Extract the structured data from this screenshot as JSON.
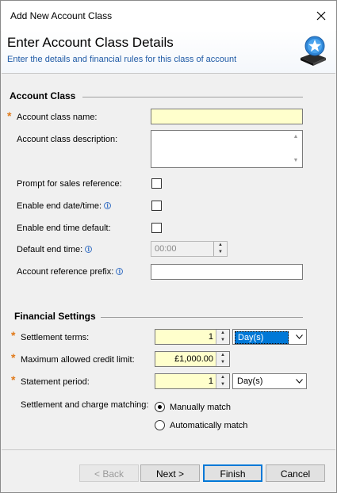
{
  "window": {
    "title": "Add New Account Class"
  },
  "header": {
    "heading": "Enter Account Class Details",
    "subtitle": "Enter the details and financial rules for this class of account"
  },
  "account_class": {
    "section_title": "Account Class",
    "name_label": "Account class name:",
    "name_value": "",
    "description_label": "Account class description:",
    "description_value": "",
    "prompt_sales_ref_label": "Prompt for sales reference:",
    "prompt_sales_ref_checked": false,
    "enable_end_datetime_label": "Enable end date/time:",
    "enable_end_datetime_checked": false,
    "enable_end_time_default_label": "Enable end time default:",
    "enable_end_time_default_checked": false,
    "default_end_time_label": "Default end time:",
    "default_end_time_value": "00:00",
    "reference_prefix_label": "Account reference prefix:",
    "reference_prefix_value": ""
  },
  "financial": {
    "section_title": "Financial Settings",
    "settlement_terms_label": "Settlement terms:",
    "settlement_terms_value": "1",
    "settlement_terms_unit": "Day(s)",
    "credit_limit_label": "Maximum allowed credit limit:",
    "credit_limit_value": "£1,000.00",
    "statement_period_label": "Statement period:",
    "statement_period_value": "1",
    "statement_period_unit": "Day(s)",
    "matching_label": "Settlement and charge matching:",
    "matching_options": [
      "Manually match",
      "Automatically match"
    ],
    "matching_selected": "Manually match"
  },
  "buttons": {
    "back": "< Back",
    "next": "Next >",
    "finish": "Finish",
    "cancel": "Cancel"
  },
  "icons": {
    "close": "close-icon",
    "logo": "wizard-star-icon",
    "info": "info-icon",
    "required": "required-asterisk-icon"
  },
  "colors": {
    "required": "#e07a1a",
    "subtitle": "#1f5aa6",
    "required_field_bg": "#ffffcc",
    "selection": "#0078d7"
  }
}
